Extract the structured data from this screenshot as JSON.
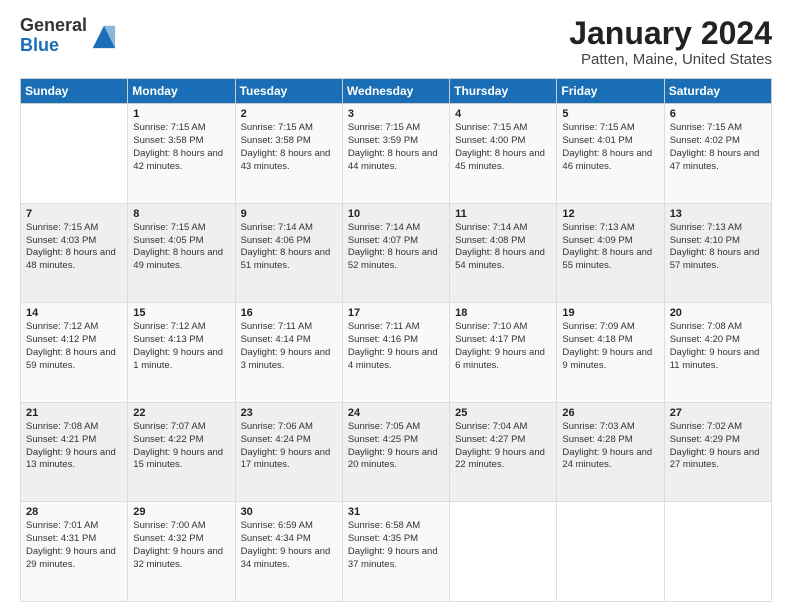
{
  "logo": {
    "general": "General",
    "blue": "Blue"
  },
  "title": "January 2024",
  "subtitle": "Patten, Maine, United States",
  "headers": [
    "Sunday",
    "Monday",
    "Tuesday",
    "Wednesday",
    "Thursday",
    "Friday",
    "Saturday"
  ],
  "weeks": [
    [
      {
        "day": "",
        "sunrise": "",
        "sunset": "",
        "daylight": ""
      },
      {
        "day": "1",
        "sunrise": "Sunrise: 7:15 AM",
        "sunset": "Sunset: 3:58 PM",
        "daylight": "Daylight: 8 hours and 42 minutes."
      },
      {
        "day": "2",
        "sunrise": "Sunrise: 7:15 AM",
        "sunset": "Sunset: 3:58 PM",
        "daylight": "Daylight: 8 hours and 43 minutes."
      },
      {
        "day": "3",
        "sunrise": "Sunrise: 7:15 AM",
        "sunset": "Sunset: 3:59 PM",
        "daylight": "Daylight: 8 hours and 44 minutes."
      },
      {
        "day": "4",
        "sunrise": "Sunrise: 7:15 AM",
        "sunset": "Sunset: 4:00 PM",
        "daylight": "Daylight: 8 hours and 45 minutes."
      },
      {
        "day": "5",
        "sunrise": "Sunrise: 7:15 AM",
        "sunset": "Sunset: 4:01 PM",
        "daylight": "Daylight: 8 hours and 46 minutes."
      },
      {
        "day": "6",
        "sunrise": "Sunrise: 7:15 AM",
        "sunset": "Sunset: 4:02 PM",
        "daylight": "Daylight: 8 hours and 47 minutes."
      }
    ],
    [
      {
        "day": "7",
        "sunrise": "Sunrise: 7:15 AM",
        "sunset": "Sunset: 4:03 PM",
        "daylight": "Daylight: 8 hours and 48 minutes."
      },
      {
        "day": "8",
        "sunrise": "Sunrise: 7:15 AM",
        "sunset": "Sunset: 4:05 PM",
        "daylight": "Daylight: 8 hours and 49 minutes."
      },
      {
        "day": "9",
        "sunrise": "Sunrise: 7:14 AM",
        "sunset": "Sunset: 4:06 PM",
        "daylight": "Daylight: 8 hours and 51 minutes."
      },
      {
        "day": "10",
        "sunrise": "Sunrise: 7:14 AM",
        "sunset": "Sunset: 4:07 PM",
        "daylight": "Daylight: 8 hours and 52 minutes."
      },
      {
        "day": "11",
        "sunrise": "Sunrise: 7:14 AM",
        "sunset": "Sunset: 4:08 PM",
        "daylight": "Daylight: 8 hours and 54 minutes."
      },
      {
        "day": "12",
        "sunrise": "Sunrise: 7:13 AM",
        "sunset": "Sunset: 4:09 PM",
        "daylight": "Daylight: 8 hours and 55 minutes."
      },
      {
        "day": "13",
        "sunrise": "Sunrise: 7:13 AM",
        "sunset": "Sunset: 4:10 PM",
        "daylight": "Daylight: 8 hours and 57 minutes."
      }
    ],
    [
      {
        "day": "14",
        "sunrise": "Sunrise: 7:12 AM",
        "sunset": "Sunset: 4:12 PM",
        "daylight": "Daylight: 8 hours and 59 minutes."
      },
      {
        "day": "15",
        "sunrise": "Sunrise: 7:12 AM",
        "sunset": "Sunset: 4:13 PM",
        "daylight": "Daylight: 9 hours and 1 minute."
      },
      {
        "day": "16",
        "sunrise": "Sunrise: 7:11 AM",
        "sunset": "Sunset: 4:14 PM",
        "daylight": "Daylight: 9 hours and 3 minutes."
      },
      {
        "day": "17",
        "sunrise": "Sunrise: 7:11 AM",
        "sunset": "Sunset: 4:16 PM",
        "daylight": "Daylight: 9 hours and 4 minutes."
      },
      {
        "day": "18",
        "sunrise": "Sunrise: 7:10 AM",
        "sunset": "Sunset: 4:17 PM",
        "daylight": "Daylight: 9 hours and 6 minutes."
      },
      {
        "day": "19",
        "sunrise": "Sunrise: 7:09 AM",
        "sunset": "Sunset: 4:18 PM",
        "daylight": "Daylight: 9 hours and 9 minutes."
      },
      {
        "day": "20",
        "sunrise": "Sunrise: 7:08 AM",
        "sunset": "Sunset: 4:20 PM",
        "daylight": "Daylight: 9 hours and 11 minutes."
      }
    ],
    [
      {
        "day": "21",
        "sunrise": "Sunrise: 7:08 AM",
        "sunset": "Sunset: 4:21 PM",
        "daylight": "Daylight: 9 hours and 13 minutes."
      },
      {
        "day": "22",
        "sunrise": "Sunrise: 7:07 AM",
        "sunset": "Sunset: 4:22 PM",
        "daylight": "Daylight: 9 hours and 15 minutes."
      },
      {
        "day": "23",
        "sunrise": "Sunrise: 7:06 AM",
        "sunset": "Sunset: 4:24 PM",
        "daylight": "Daylight: 9 hours and 17 minutes."
      },
      {
        "day": "24",
        "sunrise": "Sunrise: 7:05 AM",
        "sunset": "Sunset: 4:25 PM",
        "daylight": "Daylight: 9 hours and 20 minutes."
      },
      {
        "day": "25",
        "sunrise": "Sunrise: 7:04 AM",
        "sunset": "Sunset: 4:27 PM",
        "daylight": "Daylight: 9 hours and 22 minutes."
      },
      {
        "day": "26",
        "sunrise": "Sunrise: 7:03 AM",
        "sunset": "Sunset: 4:28 PM",
        "daylight": "Daylight: 9 hours and 24 minutes."
      },
      {
        "day": "27",
        "sunrise": "Sunrise: 7:02 AM",
        "sunset": "Sunset: 4:29 PM",
        "daylight": "Daylight: 9 hours and 27 minutes."
      }
    ],
    [
      {
        "day": "28",
        "sunrise": "Sunrise: 7:01 AM",
        "sunset": "Sunset: 4:31 PM",
        "daylight": "Daylight: 9 hours and 29 minutes."
      },
      {
        "day": "29",
        "sunrise": "Sunrise: 7:00 AM",
        "sunset": "Sunset: 4:32 PM",
        "daylight": "Daylight: 9 hours and 32 minutes."
      },
      {
        "day": "30",
        "sunrise": "Sunrise: 6:59 AM",
        "sunset": "Sunset: 4:34 PM",
        "daylight": "Daylight: 9 hours and 34 minutes."
      },
      {
        "day": "31",
        "sunrise": "Sunrise: 6:58 AM",
        "sunset": "Sunset: 4:35 PM",
        "daylight": "Daylight: 9 hours and 37 minutes."
      },
      {
        "day": "",
        "sunrise": "",
        "sunset": "",
        "daylight": ""
      },
      {
        "day": "",
        "sunrise": "",
        "sunset": "",
        "daylight": ""
      },
      {
        "day": "",
        "sunrise": "",
        "sunset": "",
        "daylight": ""
      }
    ]
  ]
}
